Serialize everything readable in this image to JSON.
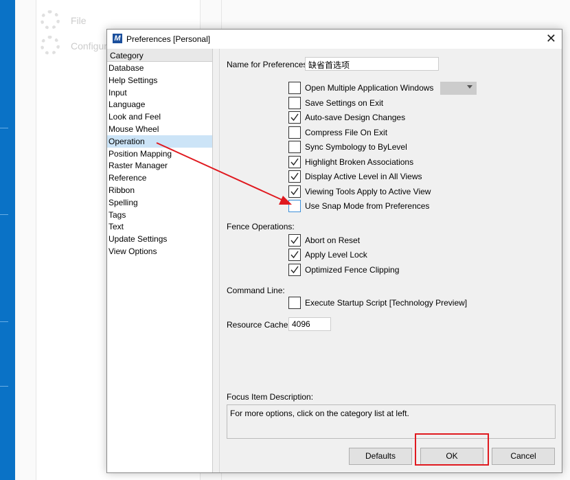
{
  "background": {
    "items": [
      "File",
      "Configur"
    ]
  },
  "dialog": {
    "title": "Preferences [Personal]",
    "category_header": "Category",
    "categories": [
      "Database",
      "Help Settings",
      "Input",
      "Language",
      "Look and Feel",
      "Mouse Wheel",
      "Operation",
      "Position Mapping",
      "Raster Manager",
      "Reference",
      "Ribbon",
      "Spelling",
      "Tags",
      "Text",
      "Update Settings",
      "View Options"
    ],
    "selected_category": "Operation",
    "name_label": "Name for Preferences:",
    "name_value": "缺省首选项",
    "options": [
      {
        "label": "Open Multiple Application Windows",
        "checked": false
      },
      {
        "label": "Save Settings on Exit",
        "checked": false
      },
      {
        "label": "Auto-save Design Changes",
        "checked": true
      },
      {
        "label": "Compress File On Exit",
        "checked": false
      },
      {
        "label": "Sync Symbology to ByLevel",
        "checked": false
      },
      {
        "label": "Highlight Broken Associations",
        "checked": true
      },
      {
        "label": "Display Active Level in All Views",
        "checked": true
      },
      {
        "label": "Viewing Tools Apply to Active View",
        "checked": true
      },
      {
        "label": "Use Snap Mode from Preferences",
        "checked": false
      }
    ],
    "fence_label": "Fence Operations:",
    "fence_options": [
      {
        "label": "Abort on Reset",
        "checked": true
      },
      {
        "label": "Apply Level Lock",
        "checked": true
      },
      {
        "label": "Optimized Fence Clipping",
        "checked": true
      }
    ],
    "command_label": "Command Line:",
    "command_options": [
      {
        "label": "Execute Startup Script [Technology Preview]",
        "checked": false
      }
    ],
    "cache_label": "Resource Cache:",
    "cache_value": "4096",
    "focus_label": "Focus Item Description:",
    "focus_text": "For more options, click on the category list at left.",
    "buttons": {
      "defaults": "Defaults",
      "ok": "OK",
      "cancel": "Cancel"
    }
  },
  "annotation_color": "#e0191f"
}
